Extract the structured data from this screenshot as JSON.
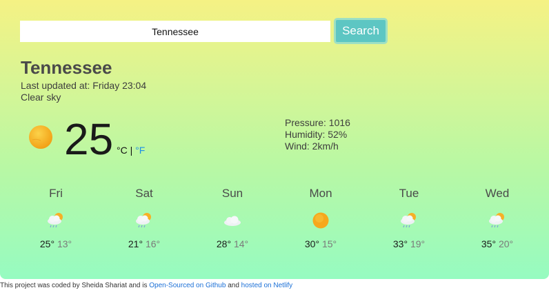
{
  "search": {
    "value": "Tennessee",
    "button_label": "Search"
  },
  "current": {
    "city": "Tennessee",
    "updated": "Last updated at: Friday 23:04",
    "description": "Clear sky",
    "temperature": "25",
    "unit_c": "°C",
    "unit_sep": " | ",
    "unit_f": "°F",
    "icon": "sun-icon",
    "pressure": "Pressure: 1016",
    "humidity": "Humidity: 52%",
    "wind": "Wind: 2km/h"
  },
  "forecast": [
    {
      "day": "Fri",
      "icon": "cloud-rain-sun-icon",
      "high": "25°",
      "low": "13°"
    },
    {
      "day": "Sat",
      "icon": "cloud-rain-sun-icon",
      "high": "21°",
      "low": "16°"
    },
    {
      "day": "Sun",
      "icon": "cloud-icon",
      "high": "28°",
      "low": "14°"
    },
    {
      "day": "Mon",
      "icon": "sun-icon",
      "high": "30°",
      "low": "15°"
    },
    {
      "day": "Tue",
      "icon": "cloud-rain-sun-icon",
      "high": "33°",
      "low": "19°"
    },
    {
      "day": "Wed",
      "icon": "cloud-rain-sun-icon",
      "high": "35°",
      "low": "20°"
    }
  ],
  "footer": {
    "text_1": "This project was coded by Sheida Shariat and is ",
    "link_github": "Open-Sourced on Github",
    "text_2": " and ",
    "link_netlify": "hosted on Netlify"
  },
  "colors": {
    "button": "#5dc6c3",
    "sun": "#f6a81c",
    "link": "#1a8fe8"
  }
}
